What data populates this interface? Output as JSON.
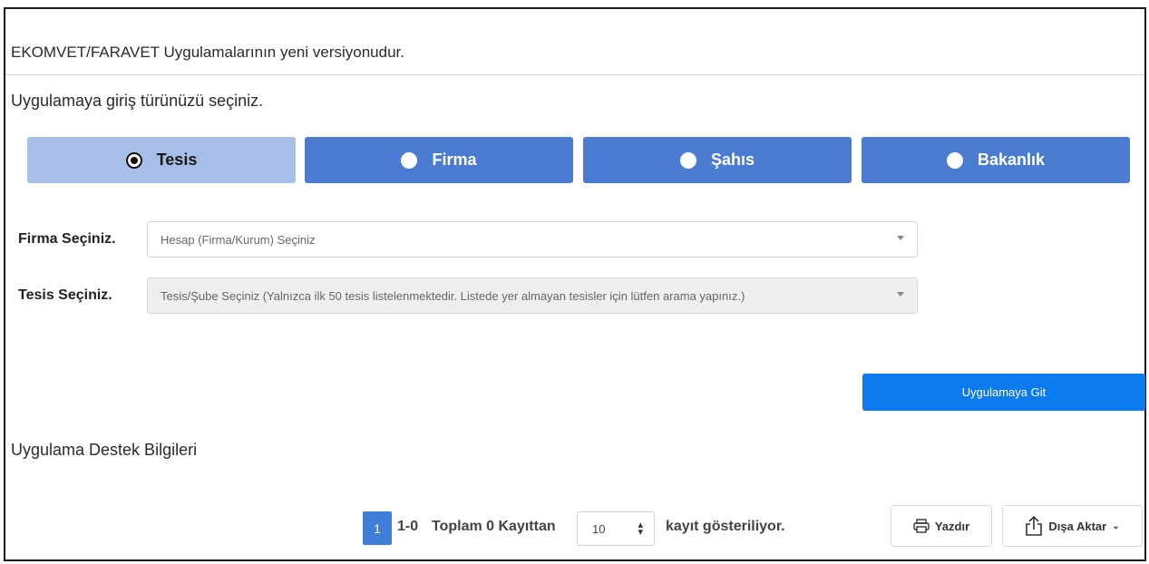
{
  "header": {
    "title": "EKOMVET/FARAVET Uygulamalarının yeni versiyonudur.",
    "subtitle": "Uygulamaya giriş türünüzü seçiniz."
  },
  "login_types": [
    {
      "label": "Tesis",
      "selected": true
    },
    {
      "label": "Firma",
      "selected": false
    },
    {
      "label": "Şahıs",
      "selected": false
    },
    {
      "label": "Bakanlık",
      "selected": false
    }
  ],
  "form": {
    "firma_label": "Firma Seçiniz.",
    "firma_placeholder": "Hesap (Firma/Kurum) Seçiniz",
    "tesis_label": "Tesis Seçiniz.",
    "tesis_placeholder": "Tesis/Şube Seçiniz (Yalnızca ilk 50 tesis listelenmektedir. Listede yer almayan tesisler için lütfen arama yapınız.)",
    "go_button": "Uygulamaya Git"
  },
  "support": {
    "title": "Uygulama Destek Bilgileri"
  },
  "pagination": {
    "current_page": "1",
    "range": "1-0",
    "total_text": "Toplam 0 Kayıttan",
    "page_size": "10",
    "records_text": "kayıt gösteriliyor."
  },
  "actions": {
    "print_label": "Yazdır",
    "export_label": "Dışa Aktar"
  },
  "colors": {
    "tab_active": "#a7bee8",
    "tab_inactive": "#4a7bd0",
    "primary_button": "#0d7bf0",
    "pager_active": "#3f7dd9"
  }
}
